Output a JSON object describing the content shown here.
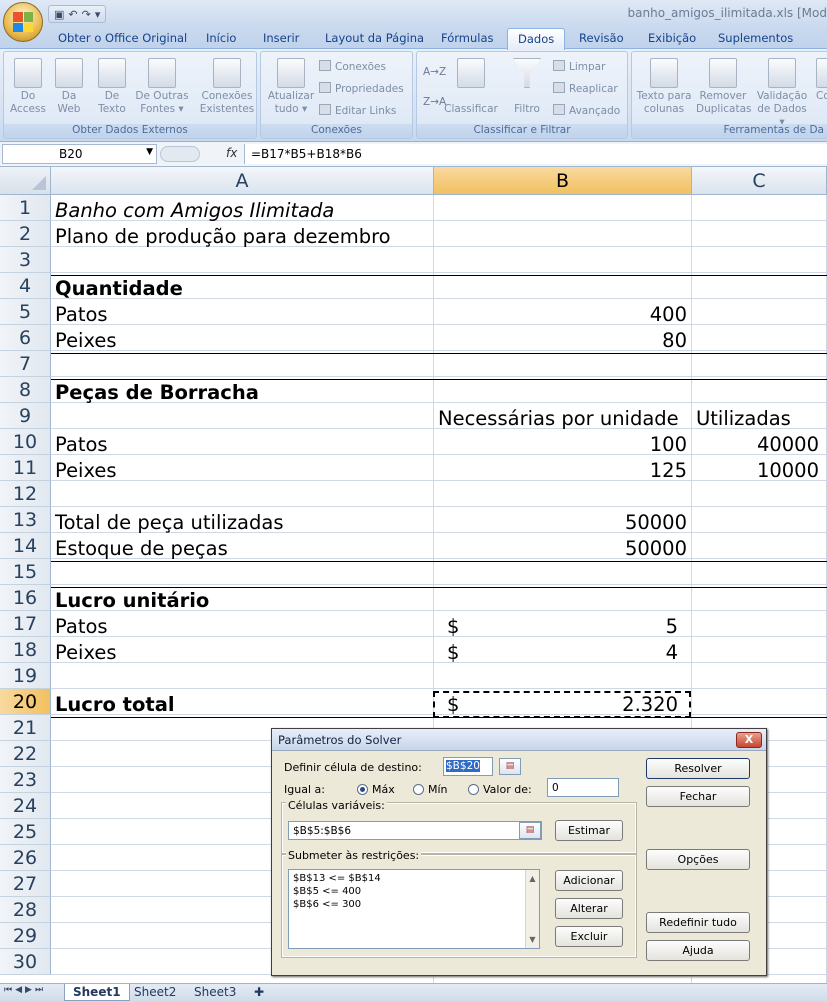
{
  "window": {
    "title": "banho_amigos_ilimitada.xls [Mod",
    "qat_icons": [
      "save-icon",
      "undo-icon",
      "redo-icon",
      "customize-icon"
    ]
  },
  "ribbon": {
    "tabs": [
      "Obter o Office Original",
      "Início",
      "Inserir",
      "Layout da Página",
      "Fórmulas",
      "Dados",
      "Revisão",
      "Exibição",
      "Suplementos"
    ],
    "active_tab": "Dados",
    "groups": {
      "obter": {
        "name": "Obter Dados Externos",
        "buttons": [
          {
            "line1": "Do",
            "line2": "Access"
          },
          {
            "line1": "Da",
            "line2": "Web"
          },
          {
            "line1": "De",
            "line2": "Texto"
          },
          {
            "line1": "De Outras",
            "line2": "Fontes ▾"
          },
          {
            "line1": "Conexões",
            "line2": "Existentes"
          }
        ]
      },
      "conexoes": {
        "name": "Conexões",
        "refresh": {
          "line1": "Atualizar",
          "line2": "tudo ▾"
        },
        "small": [
          "Conexões",
          "Propriedades",
          "Editar Links"
        ]
      },
      "classificar": {
        "name": "Classificar e Filtrar",
        "sort_az": "A→Z",
        "sort_za": "Z→A",
        "classificar": "Classificar",
        "filtro": "Filtro",
        "small": [
          "Limpar",
          "Reaplicar",
          "Avançado"
        ]
      },
      "ferramentas": {
        "name": "Ferramentas de Da",
        "buttons": [
          {
            "line1": "Texto para",
            "line2": "colunas"
          },
          {
            "line1": "Remover",
            "line2": "Duplicatas"
          },
          {
            "line1": "Validação",
            "line2": "de Dados ▾"
          },
          {
            "line1": "Co",
            "line2": ""
          }
        ]
      }
    }
  },
  "formula_bar": {
    "name_box": "B20",
    "fx": "fx",
    "formula": "=B17*B5+B18*B6"
  },
  "sheet": {
    "columns": [
      "A",
      "B",
      "C"
    ],
    "selected_column": "B",
    "selected_row": "20",
    "rows": [
      "1",
      "2",
      "3",
      "4",
      "5",
      "6",
      "7",
      "8",
      "9",
      "10",
      "11",
      "12",
      "13",
      "14",
      "15",
      "16",
      "17",
      "18",
      "19",
      "20",
      "21",
      "22",
      "23",
      "24",
      "25",
      "26",
      "27",
      "28",
      "29",
      "30"
    ],
    "cells": {
      "a1": "Banho com Amigos Ilimitada",
      "a2": "Plano de produção para dezembro",
      "a4": "Quantidade",
      "a5": "Patos",
      "b5": "400",
      "a6": "Peixes",
      "b6": "80",
      "a8": "Peças de Borracha",
      "b9": "Necessárias por unidade",
      "c9": "Utilizadas",
      "a10": "Patos",
      "b10": "100",
      "c10": "40000",
      "a11": "Peixes",
      "b11": "125",
      "c11": "10000",
      "a13": "Total de peça utilizadas",
      "b13": "50000",
      "a14": "Estoque de peças",
      "b14": "50000",
      "a16": "Lucro unitário",
      "a17": "Patos",
      "b17_cur": "$",
      "b17": "5",
      "a18": "Peixes",
      "b18_cur": "$",
      "b18": "4",
      "a20": "Lucro total",
      "b20_cur": "$",
      "b20": "2.320"
    },
    "tabs": [
      "Sheet1",
      "Sheet2",
      "Sheet3"
    ],
    "active_tab": "Sheet1"
  },
  "solver": {
    "title": "Parâmetros do Solver",
    "close": "X",
    "target_label": "Definir célula de destino:",
    "target_value": "$B$20",
    "equal_label": "Igual a:",
    "opt_max": "Máx",
    "opt_min": "Mín",
    "opt_value": "Valor de:",
    "value_field": "0",
    "selected_option": "max",
    "vars_label": "Células variáveis:",
    "vars_value": "$B$5:$B$6",
    "constraints_label": "Submeter às restrições:",
    "constraints": [
      "$B$13 <= $B$14",
      "$B$5 <= 400",
      "$B$6 <= 300"
    ],
    "buttons": {
      "resolver": "Resolver",
      "fechar": "Fechar",
      "estimar": "Estimar",
      "opcoes": "Opções",
      "adicionar": "Adicionar",
      "alterar": "Alterar",
      "excluir": "Excluir",
      "redefinir": "Redefinir tudo",
      "ajuda": "Ajuda"
    }
  }
}
